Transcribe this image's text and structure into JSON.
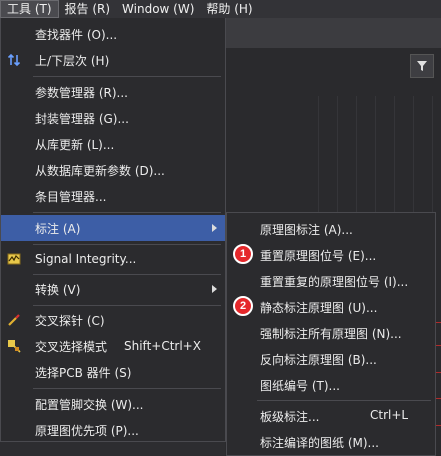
{
  "menubar": {
    "items": [
      {
        "label": "工具 (T)",
        "active": true
      },
      {
        "label": "报告 (R)"
      },
      {
        "label": "Window (W)"
      },
      {
        "label": "帮助 (H)"
      }
    ]
  },
  "tools_menu": {
    "items": [
      {
        "label": "查找器件 (O)...",
        "icon": "none"
      },
      {
        "label": "上/下层次 (H)",
        "icon": "up-down-arrows-icon"
      },
      {
        "label": "参数管理器 (R)...",
        "icon": "none"
      },
      {
        "label": "封装管理器 (G)...",
        "icon": "none"
      },
      {
        "label": "从库更新 (L)...",
        "icon": "none"
      },
      {
        "label": "从数据库更新参数 (D)...",
        "icon": "none"
      },
      {
        "label": "条目管理器...",
        "icon": "none"
      },
      {
        "label": "标注 (A)",
        "icon": "none",
        "submenu": true
      },
      {
        "label": "Signal Integrity...",
        "icon": "signal-integrity-icon"
      },
      {
        "label": "转换 (V)",
        "icon": "none",
        "submenu": true
      },
      {
        "label": "交叉探针 (C)",
        "icon": "cross-probe-icon"
      },
      {
        "label": "交叉选择模式",
        "shortcut": "Shift+Ctrl+X",
        "icon": "cross-select-icon"
      },
      {
        "label": "选择PCB 器件 (S)",
        "icon": "none"
      },
      {
        "label": "配置管脚交换 (W)...",
        "icon": "none"
      },
      {
        "label": "原理图优先项 (P)...",
        "icon": "none"
      }
    ]
  },
  "annotate_submenu": {
    "items": [
      {
        "label": "原理图标注 (A)..."
      },
      {
        "label": "重置原理图位号 (E)...",
        "badge": "1"
      },
      {
        "label": "重置重复的原理图位号 (I)..."
      },
      {
        "label": "静态标注原理图 (U)...",
        "badge": "2"
      },
      {
        "label": "强制标注所有原理图 (N)..."
      },
      {
        "label": "反向标注原理图 (B)..."
      },
      {
        "label": "图纸编号 (T)..."
      },
      {
        "label": "板级标注...",
        "shortcut": "Ctrl+L"
      },
      {
        "label": "标注编译的图纸 (M)..."
      }
    ]
  },
  "colors": {
    "highlight": "#3d5ea6",
    "badge": "#e5282b",
    "menu_bg": "#2b2b2e"
  }
}
